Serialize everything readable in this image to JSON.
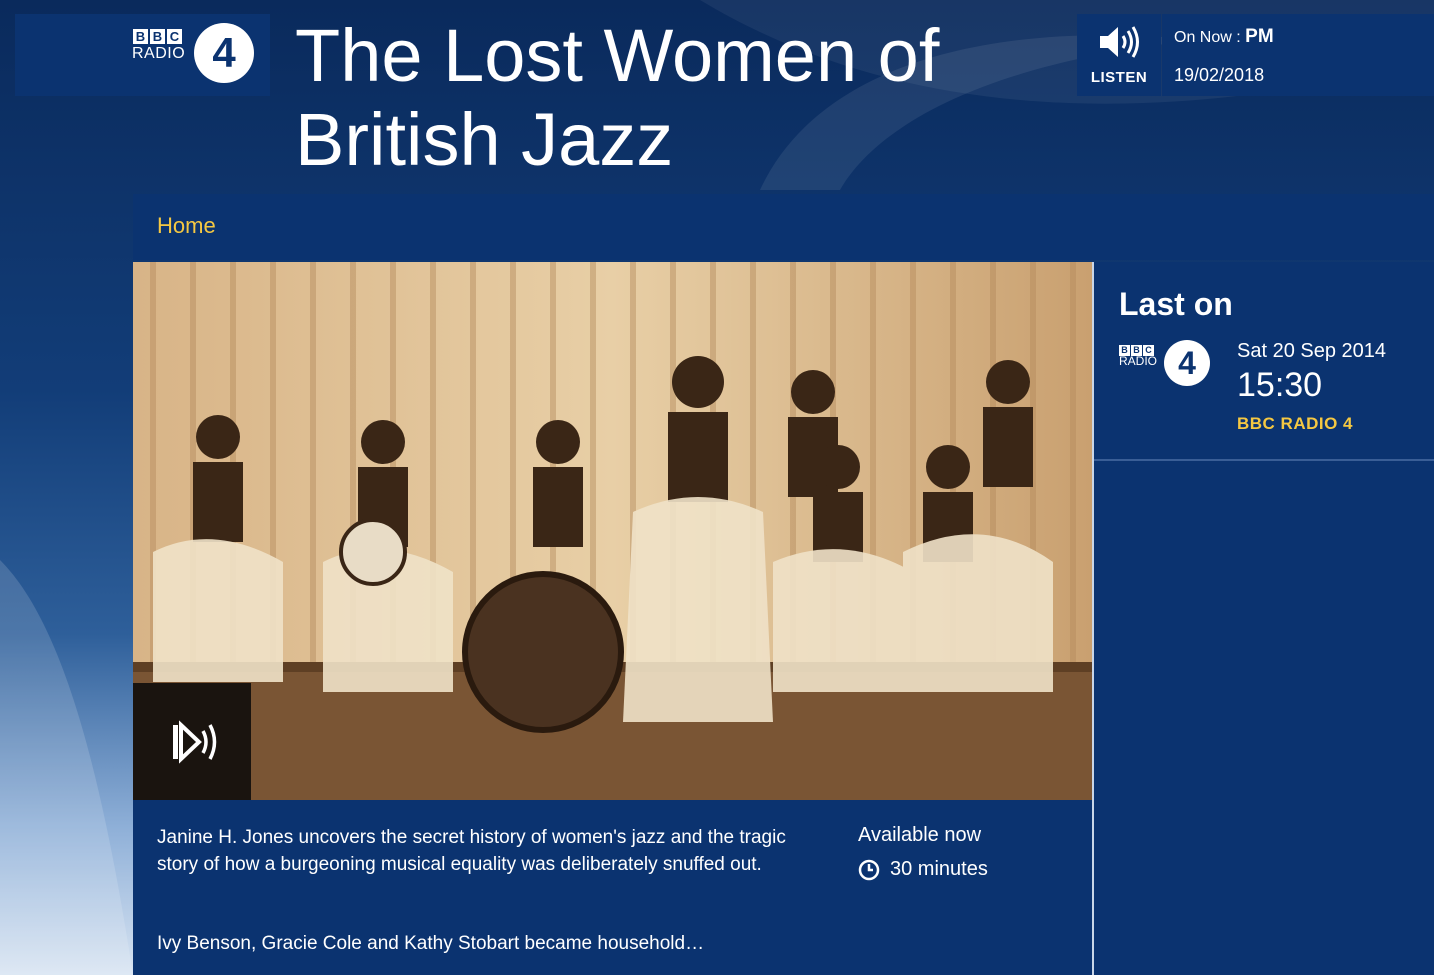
{
  "brand": {
    "blocks": [
      "B",
      "B",
      "C"
    ],
    "radio_word": "RADIO",
    "station_number": "4"
  },
  "programme": {
    "title": "The Lost Women of British Jazz"
  },
  "listen": {
    "label": "LISTEN",
    "icon": "speaker-icon"
  },
  "on_now": {
    "prefix": "On Now : ",
    "programme": "PM",
    "date": "19/02/2018"
  },
  "nav": {
    "home_label": "Home"
  },
  "hero": {
    "image_subject": "photo of women's jazz band on stage",
    "play_icon": "audio-play-icon"
  },
  "description": {
    "summary": "Janine H. Jones uncovers the secret history of women's jazz and the tragic story of how a burgeoning musical equality was deliberately snuffed out.",
    "more": "Ivy Benson, Gracie Cole and Kathy Stobart became household…",
    "availability": "Available now",
    "duration": "30 minutes",
    "duration_icon": "clock-icon"
  },
  "last_on": {
    "heading": "Last on",
    "date": "Sat 20 Sep 2014",
    "time": "15:30",
    "station": "BBC RADIO 4"
  },
  "colors": {
    "panel": "#0b3370",
    "accent": "#f5c842"
  }
}
